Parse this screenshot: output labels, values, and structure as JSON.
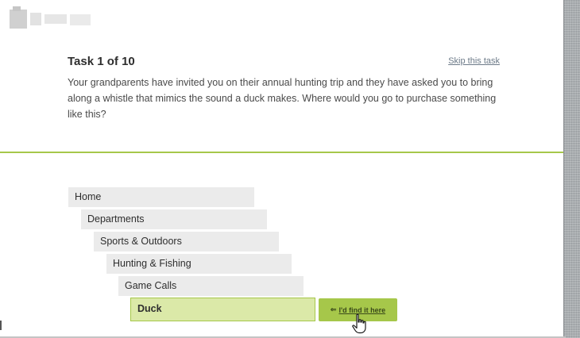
{
  "task": {
    "title": "Task 1 of 10",
    "skip_label": "Skip this task",
    "description": "Your grandparents have invited you on their annual hunting trip and they have asked you to bring along a whistle that mimics the sound a duck makes. Where would you go to purchase something like this?"
  },
  "tree": {
    "items": [
      {
        "label": "Home"
      },
      {
        "label": "Departments"
      },
      {
        "label": "Sports & Outdoors"
      },
      {
        "label": "Hunting & Fishing"
      },
      {
        "label": "Game Calls"
      },
      {
        "label": "Duck",
        "selected": true
      }
    ],
    "find_button_label": "I'd find it here",
    "find_button_arrow": "⇐"
  },
  "colors": {
    "accent_green": "#a6c74a",
    "selected_bg": "#dbe9a8",
    "item_bg": "#ebebeb"
  },
  "icons": {
    "logo": "blurred-logo",
    "arrow": "arrow-left-icon",
    "cursor": "hand-pointer-cursor"
  }
}
